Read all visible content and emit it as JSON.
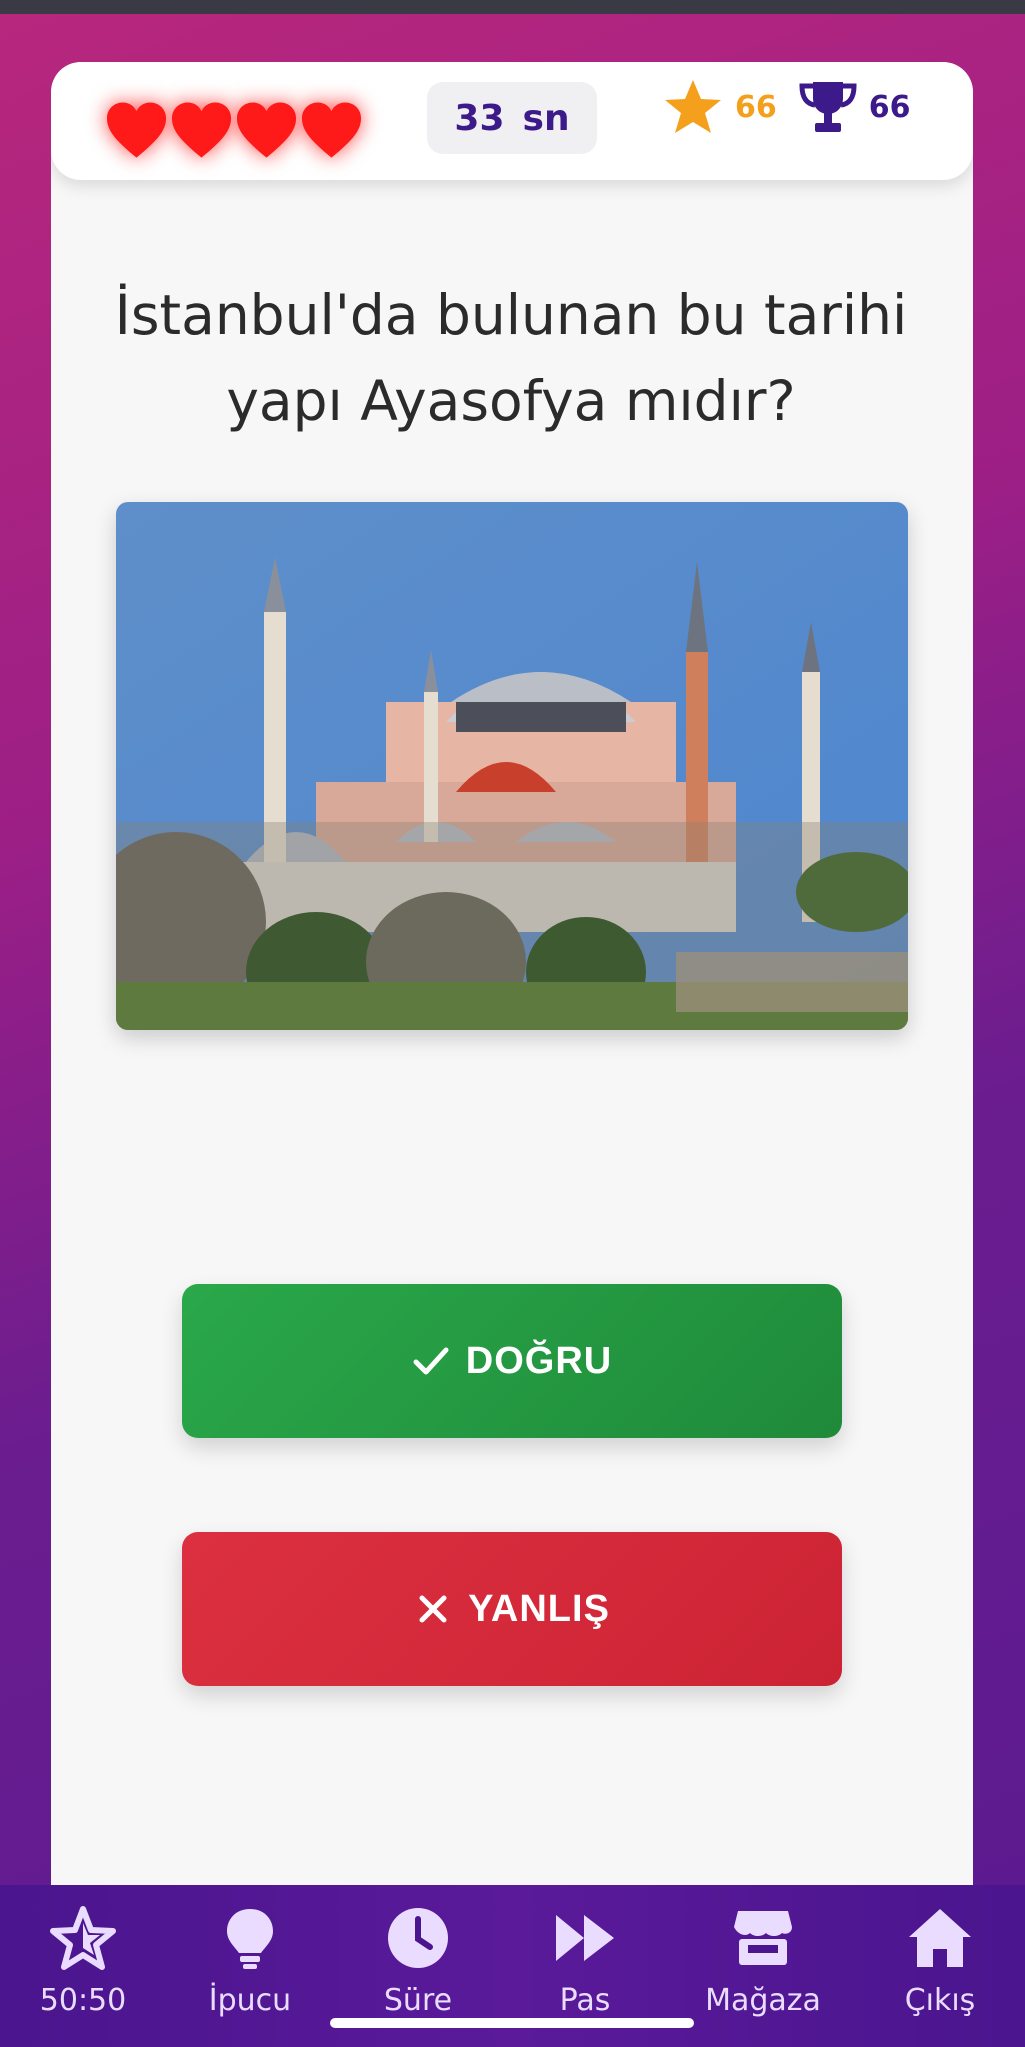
{
  "hud": {
    "lives": 4,
    "timer_value": "33",
    "timer_unit": "sn",
    "stars": "66",
    "trophies": "66"
  },
  "question": {
    "text": "İstanbul'da bulunan bu tarihi yapı Ayasofya mıdır?"
  },
  "answers": {
    "true_label": "DOĞRU",
    "false_label": "YANLIŞ"
  },
  "bottom_nav": {
    "items": [
      {
        "label": "50:50",
        "icon": "star-outline-icon"
      },
      {
        "label": "İpucu",
        "icon": "lightbulb-icon"
      },
      {
        "label": "Süre",
        "icon": "clock-icon"
      },
      {
        "label": "Pas",
        "icon": "fast-forward-icon"
      },
      {
        "label": "Mağaza",
        "icon": "store-icon"
      },
      {
        "label": "Çıkış",
        "icon": "home-icon"
      }
    ]
  },
  "colors": {
    "heart": "#ff1a1a",
    "star": "#f4a01c",
    "brand_purple": "#3d1a8a",
    "true_button": "#28a745",
    "false_button": "#dc3545",
    "nav_bg": "#4a158e"
  }
}
